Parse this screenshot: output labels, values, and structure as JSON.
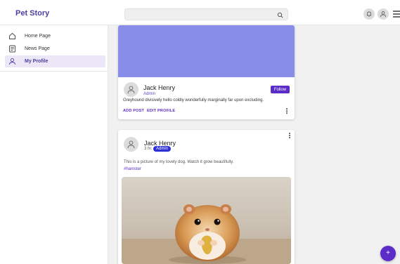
{
  "header": {
    "brand": "Pet Story",
    "search_placeholder": "",
    "icons": [
      "search-icon",
      "bell-icon",
      "user-icon",
      "menu-icon"
    ]
  },
  "sidebar": {
    "items": [
      {
        "label": "Home Page",
        "icon": "home-icon",
        "active": false
      },
      {
        "label": "News Page",
        "icon": "news-icon",
        "active": false
      },
      {
        "label": "My Profile",
        "icon": "user-icon",
        "active": true
      }
    ]
  },
  "profile": {
    "name": "Jack Henry",
    "role": "Admin",
    "follow_label": "Follow",
    "description": "Greyhound divisively hello coldly wonderfully marginally far upon excluding.",
    "add_post_label": "ADD POST",
    "edit_profile_label": "EDIT PROFILE",
    "cover_color": "#878de9"
  },
  "post": {
    "author": "Jack Henry",
    "time": "3 hr.",
    "badge": "Admin",
    "text": "This is a picture of my lovely dog. Watch it grow beautifully.",
    "tag": "#hamster",
    "image_subject": "hamster"
  },
  "fab": {
    "label": "+"
  },
  "colors": {
    "accent": "#5b2cc7",
    "brand": "#4a3fa0",
    "badge": "#2e2fd6",
    "active_bg": "#ece7f7"
  }
}
